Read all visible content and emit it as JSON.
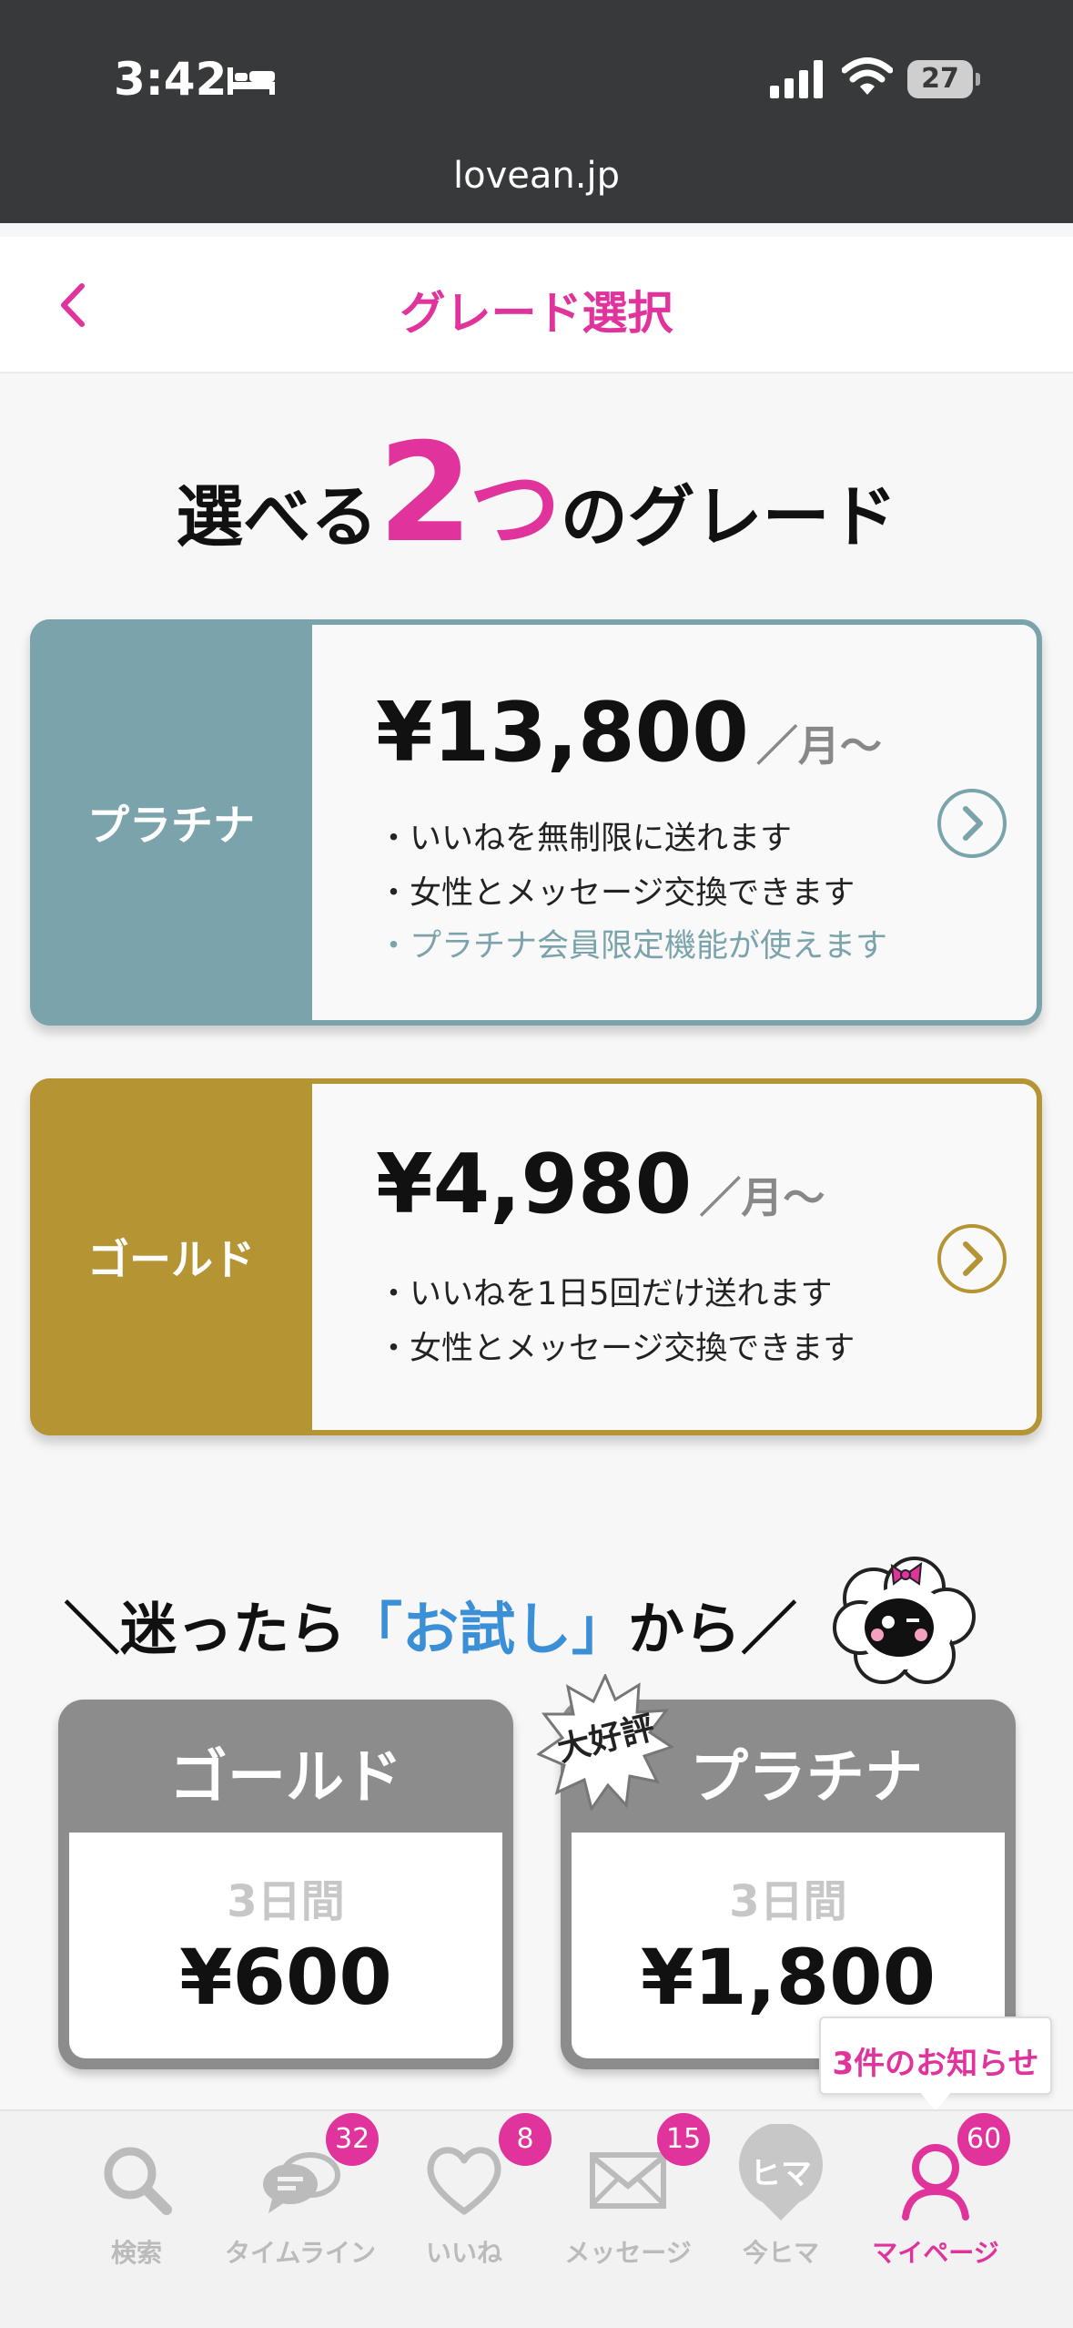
{
  "status_bar": {
    "time": "3:42",
    "battery": "27"
  },
  "browser": {
    "url": "lovean.jp"
  },
  "header": {
    "title": "グレード選択"
  },
  "hero": {
    "pre": "選べる",
    "number": "2",
    "counter": "つ",
    "post": "のグレード"
  },
  "plans": [
    {
      "name": "プラチナ",
      "price": "¥13,800",
      "per": "／月〜",
      "color": "#7aa3ac",
      "features": [
        "・いいねを無制限に送れます",
        "・女性とメッセージ交換できます",
        "・プラチナ会員限定機能が使えます"
      ]
    },
    {
      "name": "ゴールド",
      "price": "¥4,980",
      "per": "／月〜",
      "color": "#b59433",
      "features": [
        "・いいねを1日5回だけ送れます",
        "・女性とメッセージ交換できます"
      ]
    }
  ],
  "trial": {
    "heading_pre": "＼迷ったら",
    "heading_highlight": "「お試し」",
    "heading_post": "から／",
    "cards": [
      {
        "name": "ゴールド",
        "days": "3日間",
        "price": "¥600"
      },
      {
        "name": "プラチナ",
        "days": "3日間",
        "price": "¥1,800",
        "badge": "大好評"
      }
    ]
  },
  "notice": {
    "text": "3件のお知らせ"
  },
  "bottom_nav": [
    {
      "label": "検索",
      "icon": "search-icon"
    },
    {
      "label": "タイムライン",
      "icon": "chat-bubbles-icon",
      "badge": "32"
    },
    {
      "label": "いいね",
      "icon": "heart-icon",
      "badge": "8"
    },
    {
      "label": "メッセージ",
      "icon": "envelope-icon",
      "badge": "15"
    },
    {
      "label": "今ヒマ",
      "icon": "hima-icon",
      "icon_text": "ヒマ"
    },
    {
      "label": "マイページ",
      "icon": "person-icon",
      "badge": "60",
      "active": true
    }
  ],
  "colors": {
    "accent": "#e0339c",
    "platinum": "#7aa3ac",
    "gold": "#b59433",
    "trial_blue": "#3a8fd6"
  }
}
